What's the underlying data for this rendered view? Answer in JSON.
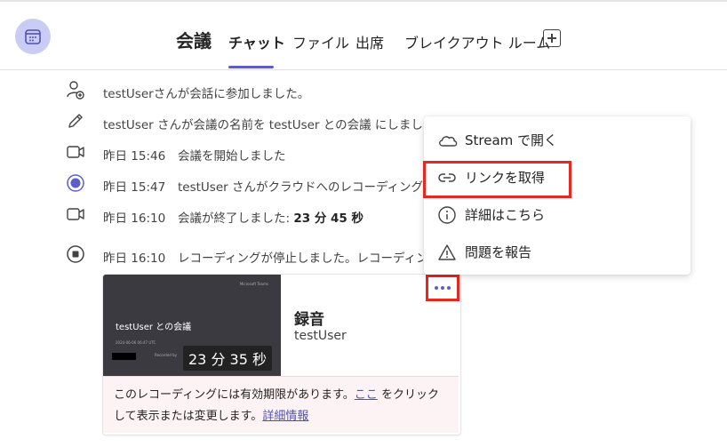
{
  "header": {
    "title": "会議",
    "tabs": [
      {
        "label": "チャット"
      },
      {
        "label": "ファイル"
      },
      {
        "label": "出席"
      },
      {
        "label": "ブレイクアウト ルーム"
      }
    ]
  },
  "events": [
    {
      "icon": "person-add-icon",
      "time": "",
      "text_plain": "testUserさんが会話に参加しました。"
    },
    {
      "icon": "pencil-icon",
      "time": "",
      "text_plain": "testUser さんが会議の名前を testUser との会議 にしました。"
    },
    {
      "icon": "video-camera-icon",
      "time": "昨日 15:46",
      "text_plain": "会議を開始しました"
    },
    {
      "icon": "recording-icon",
      "time": "昨日 15:47",
      "text_plain": "testUser さんがクラウドへのレコーディングを開始"
    },
    {
      "icon": "video-camera-icon",
      "time": "昨日 16:10",
      "text_plain": "会議が終了しました: ",
      "text_bold": "23 分 45 秒"
    },
    {
      "icon": "stop-icon",
      "time": "昨日 16:10",
      "text_plain": "レコーディングが停止しました。レコーディングを保存"
    }
  ],
  "recording_card": {
    "thumb_title": "testUser との会議",
    "thumb_meta": "2024-06-06 06:47 UTC",
    "thumb_meta2": "Recorded by",
    "thumb_org": "Microsoft Teams",
    "duration": "23 分 35 秒",
    "name": "録音",
    "owner": "testUser",
    "notice_text1": "このレコーディングには有効期限があります。",
    "notice_link1": "ここ",
    "notice_text2": " をクリックして表示または変更します。",
    "notice_link2": "詳細情報"
  },
  "context_menu": {
    "items": [
      {
        "icon": "cloud-icon",
        "label": "Stream で開く"
      },
      {
        "icon": "link-icon",
        "label": "リンクを取得"
      },
      {
        "icon": "info-icon",
        "label": "詳細はこちら"
      },
      {
        "icon": "warning-icon",
        "label": "問題を報告"
      }
    ]
  },
  "colors": {
    "accent": "#5b5fc7",
    "highlight": "#e8271f",
    "notice_bg": "#fdf3f4"
  }
}
